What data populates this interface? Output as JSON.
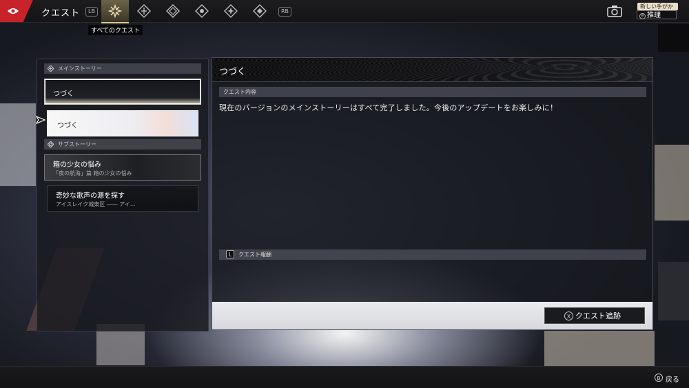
{
  "header": {
    "section_title": "クエスト",
    "lb_label": "LB",
    "rb_label": "RB",
    "tabs": [
      {
        "icon": "all-quests-icon",
        "active": true
      },
      {
        "icon": "main-story-icon",
        "active": false
      },
      {
        "icon": "side-story-icon",
        "active": false
      },
      {
        "icon": "commission-icon",
        "active": false
      },
      {
        "icon": "event-icon",
        "active": false
      },
      {
        "icon": "daily-icon",
        "active": false
      }
    ],
    "active_tab_tooltip": "すべてのクエスト",
    "clue": {
      "badge": "新しい手がかり",
      "menu_key": "≡",
      "label": "推理"
    }
  },
  "quest_list": {
    "categories": [
      {
        "label": "メインストーリー",
        "items": [
          {
            "title": "つづく",
            "subtitle": ""
          },
          {
            "title": "つづく",
            "subtitle": ""
          }
        ]
      },
      {
        "label": "サブストーリー",
        "items": [
          {
            "title": "箱の少女の悩み",
            "subtitle": "「夜の航海」篇 箱の少女の悩み"
          },
          {
            "title": "奇妙な歌声の源を探す",
            "subtitle": "アイスレイク城東区 —— アイ…"
          }
        ]
      }
    ]
  },
  "detail": {
    "title": "つづく",
    "content_header": "クエスト内容",
    "description": "現在のバージョンのメインストーリーはすべて完了しました。今後のアップデートをお楽しみに！",
    "reward_key": "L",
    "reward_header": "クエスト報酬",
    "track_key": "X",
    "track_label": "クエスト追跡"
  },
  "footer": {
    "back_key": "B",
    "back_label": "戻る"
  },
  "colors": {
    "brand_red": "#c8222a",
    "active_tab_gold": "#d8c78a"
  }
}
